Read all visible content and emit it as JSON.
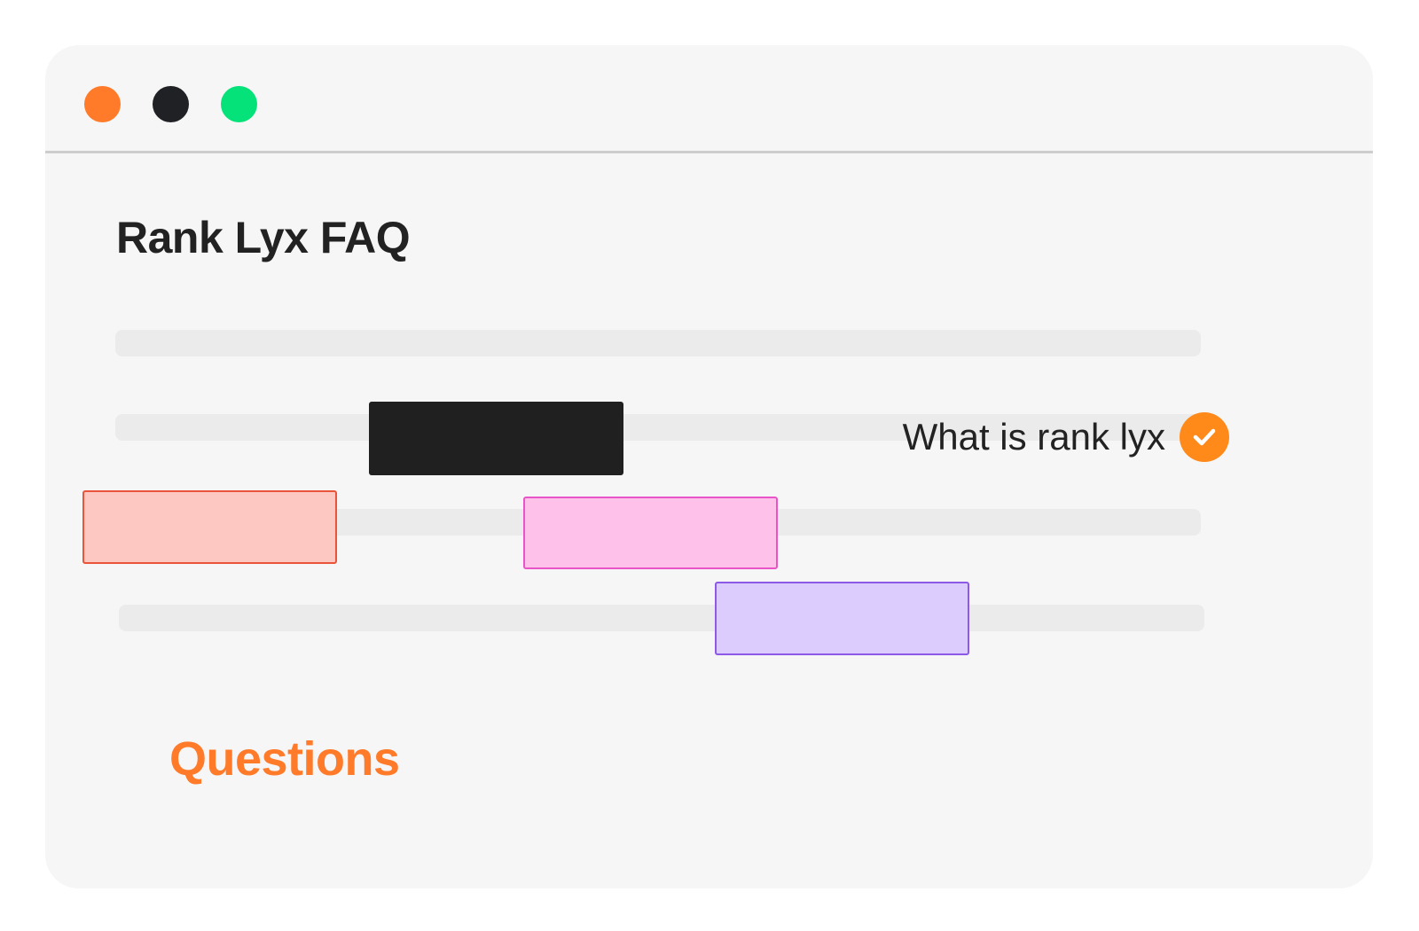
{
  "window": {
    "controls": [
      {
        "name": "close",
        "color": "#ff7a29"
      },
      {
        "name": "minimize",
        "color": "#202125"
      },
      {
        "name": "maximize",
        "color": "#06e27a"
      }
    ]
  },
  "page": {
    "title": "Rank Lyx FAQ",
    "question": "What is rank lyx",
    "question_icon": "check-circle-icon",
    "section_label": "Questions"
  },
  "colors": {
    "accent": "#ff7a29",
    "check_circle": "#ff8a1a",
    "dark_block": "#202020",
    "salmon_block_fill": "#fdc7c2",
    "salmon_block_border": "#e8553a",
    "pink_block_fill": "#fdc1ea",
    "pink_block_border": "#e955c9",
    "lavender_block_fill": "#dccbfd",
    "lavender_block_border": "#8c5ae6"
  }
}
